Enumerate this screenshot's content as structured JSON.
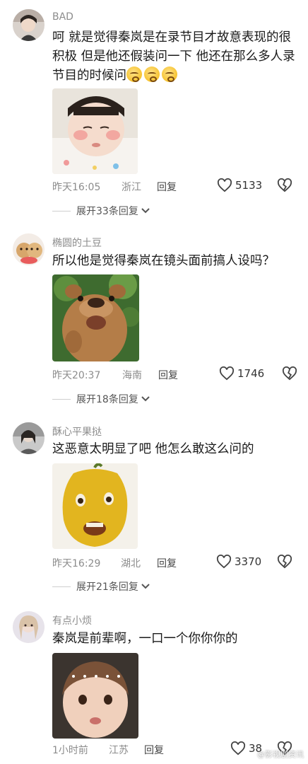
{
  "comments": [
    {
      "username": "BAD",
      "text": "呵 就是觉得秦岚是在录节目才故意表现的很积极 但是他还假装问一下 他还在那么多人录节目的时候问",
      "emoji": "slightly-frowning-emoji",
      "time": "昨天16:05",
      "location": "浙江",
      "reply": "回复",
      "likes": "5133",
      "expand": "展开33条回复"
    },
    {
      "username": "椭圆的土豆",
      "text": "所以他是觉得秦岚在镜头面前搞人设吗？",
      "time": "昨天20:37",
      "location": "海南",
      "reply": "回复",
      "likes": "1746",
      "expand": "展开18条回复"
    },
    {
      "username": "酥心平果挞",
      "text": "这恶意太明显了吧 他怎么敢这么问的",
      "time": "昨天16:29",
      "location": "湖北",
      "reply": "回复",
      "likes": "3370",
      "expand": "展开21条回复"
    },
    {
      "username": "有点小烦",
      "text": "秦岚是前辈啊，一口一个你你你的",
      "time": "1小时前",
      "location": "江苏",
      "reply": "回复",
      "likes": "38"
    }
  ],
  "icons": {
    "like": "heart-outline-icon",
    "dislike": "broken-heart-icon",
    "expand": "chevron-down-icon"
  },
  "watermark": "@影视剧资讯"
}
